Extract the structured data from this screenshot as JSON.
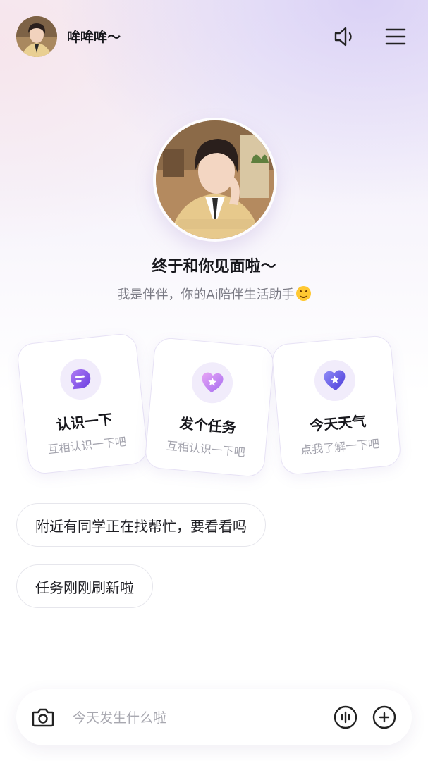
{
  "header": {
    "name": "哞哞哞～",
    "avatar_icon": "boy-portrait",
    "sound_icon": "speaker-icon",
    "menu_icon": "menu-icon"
  },
  "hero": {
    "avatar_icon": "boy-portrait",
    "title": "终于和你见面啦～",
    "subtitle": "我是伴伴，你的Ai陪伴生活助手"
  },
  "cards": [
    {
      "title": "认识一下",
      "subtitle": "互相认识一下吧",
      "icon": "chat-bubble-icon"
    },
    {
      "title": "发个任务",
      "subtitle": "互相认识一下吧",
      "icon": "heart-star-icon"
    },
    {
      "title": "今天天气",
      "subtitle": "点我了解一下吧",
      "icon": "heart-star-icon"
    }
  ],
  "chips": [
    {
      "label": "附近有同学正在找帮忙，要看看吗"
    },
    {
      "label": "任务刚刚刷新啦"
    }
  ],
  "input": {
    "placeholder": "今天发生什么啦",
    "value": ""
  },
  "colors": {
    "accent_purple": "#7b4fe0",
    "card_icon_bg": "#f1ecfb",
    "muted_text": "#a3a3ad"
  }
}
